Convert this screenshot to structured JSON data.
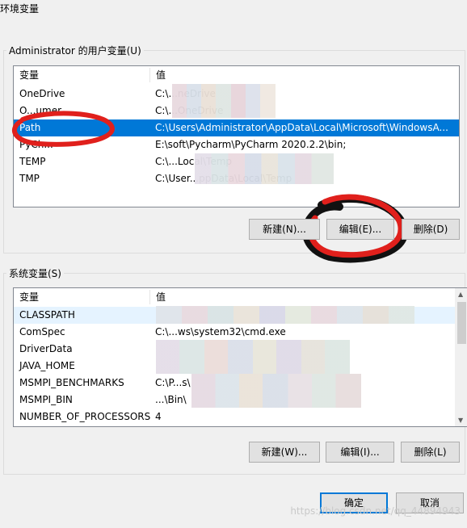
{
  "window": {
    "title": "环境变量"
  },
  "user_vars": {
    "group_label": "Administrator 的用户变量(U)",
    "col_name": "变量",
    "col_value": "值",
    "rows": [
      {
        "name": "OneDrive",
        "value": "C:\\...neDrive"
      },
      {
        "name": "O...umer",
        "value": "C:\\...OneDrive"
      },
      {
        "name": "Path",
        "value": "C:\\Users\\Administrator\\AppData\\Local\\Microsoft\\WindowsA..."
      },
      {
        "name": "PyCh...",
        "value": "E:\\soft\\Pycharm\\PyCharm 2020.2.2\\bin;"
      },
      {
        "name": "TEMP",
        "value": "C:\\...Local\\Temp"
      },
      {
        "name": "TMP",
        "value": "C:\\User...ppData\\Local\\Temp"
      }
    ],
    "buttons": {
      "new": "新建(N)...",
      "edit": "编辑(E)...",
      "delete": "删除(D)"
    }
  },
  "system_vars": {
    "group_label": "系统变量(S)",
    "col_name": "变量",
    "col_value": "值",
    "rows": [
      {
        "name": "CLASSPATH",
        "value": ""
      },
      {
        "name": "ComSpec",
        "value": "C:\\...ws\\system32\\cmd.exe"
      },
      {
        "name": "DriverData",
        "value": ""
      },
      {
        "name": "JAVA_HOME",
        "value": ""
      },
      {
        "name": "MSMPI_BENCHMARKS",
        "value": "C:\\P...s\\"
      },
      {
        "name": "MSMPI_BIN",
        "value": "...\\Bin\\"
      },
      {
        "name": "NUMBER_OF_PROCESSORS",
        "value": "4"
      }
    ],
    "buttons": {
      "new": "新建(W)...",
      "edit": "编辑(I)...",
      "delete": "删除(L)"
    }
  },
  "footer": {
    "ok": "确定",
    "cancel": "取消"
  },
  "watermark": "https://blog.csdn.net/qq_44894943",
  "colors": {
    "selection": "#0078d7",
    "annotation": "#e0201c"
  }
}
